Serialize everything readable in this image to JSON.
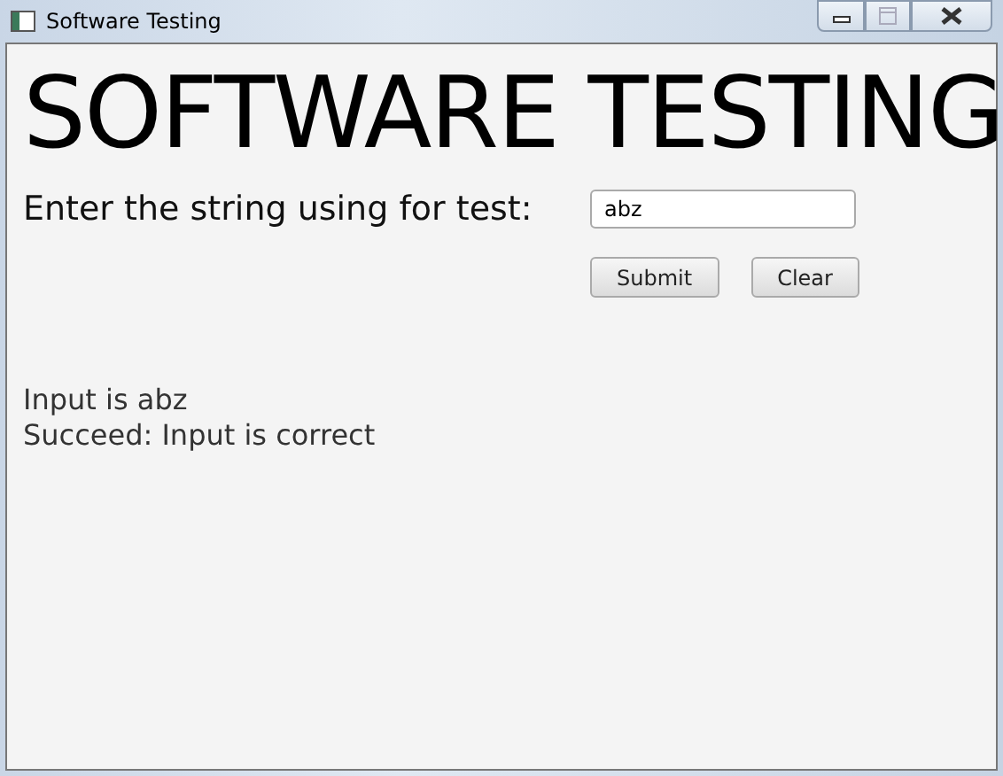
{
  "window": {
    "title": "Software Testing",
    "controls": [
      {
        "kind": "minimize",
        "disabled": false
      },
      {
        "kind": "maximize",
        "disabled": true
      },
      {
        "kind": "close",
        "disabled": false
      }
    ]
  },
  "heading": "SOFTWARE TESTING",
  "prompt": "Enter the string using for test:",
  "input": {
    "value": "abz"
  },
  "buttons": [
    "Submit",
    "Clear"
  ],
  "output": [
    "Input is abz",
    "Succeed: Input is correct"
  ]
}
